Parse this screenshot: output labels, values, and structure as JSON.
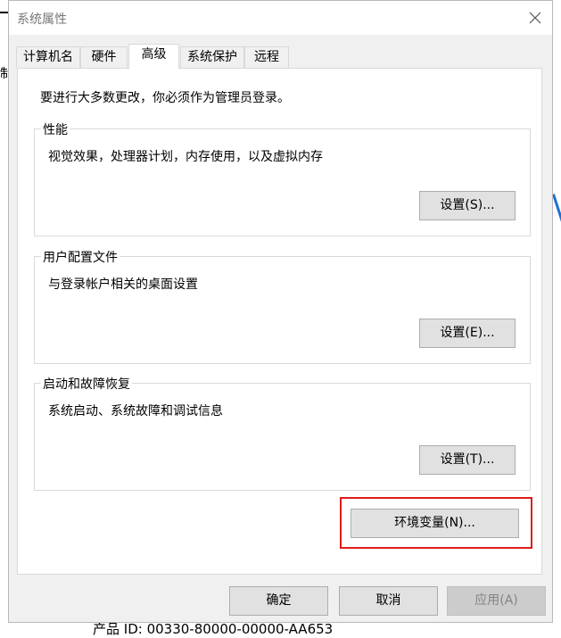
{
  "window": {
    "title": "系统属性"
  },
  "tabs": [
    {
      "label": "计算机名",
      "active": false
    },
    {
      "label": "硬件",
      "active": false
    },
    {
      "label": "高级",
      "active": true
    },
    {
      "label": "系统保护",
      "active": false
    },
    {
      "label": "远程",
      "active": false
    }
  ],
  "notice": "要进行大多数更改，你必须作为管理员登录。",
  "groups": [
    {
      "title": "性能",
      "description": "视觉效果，处理器计划，内存使用，以及虚拟内存",
      "button": "设置(S)..."
    },
    {
      "title": "用户配置文件",
      "description": "与登录帐户相关的桌面设置",
      "button": "设置(E)..."
    },
    {
      "title": "启动和故障恢复",
      "description": "系统启动、系统故障和调试信息",
      "button": "设置(T)..."
    }
  ],
  "env_button": "环境变量(N)...",
  "footer": {
    "ok": "确定",
    "cancel": "取消",
    "apply": "应用(A)",
    "apply_enabled": false
  },
  "background": {
    "left_char": "制",
    "bottom_text": "产品 ID: 00330-80000-00000-AA653"
  },
  "colors": {
    "highlight_box": "#e01b1b",
    "dialog_bg": "#f0f0f0",
    "button_bg": "#e1e1e1"
  }
}
